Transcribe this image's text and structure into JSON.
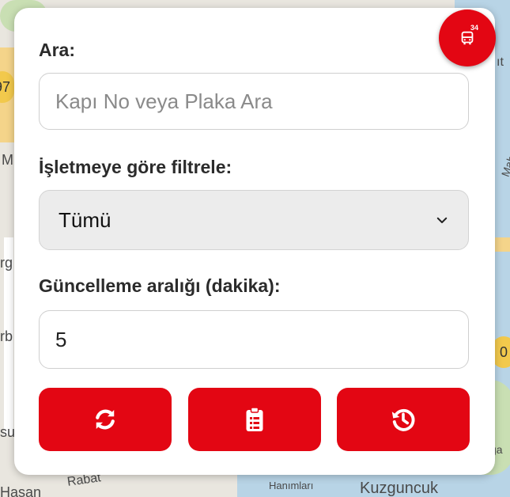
{
  "map": {
    "labels": [
      "Kuzguncuk",
      "Rabat",
      "Hanımları",
      "Hasan",
      "ğa",
      "Mah.",
      "rg",
      "rb",
      "su",
      "M",
      "ıt"
    ],
    "badges": [
      "97",
      "0"
    ]
  },
  "fab": {
    "icon": "bus-icon",
    "number": "34"
  },
  "search": {
    "label": "Ara:",
    "placeholder": "Kapı No veya Plaka Ara",
    "value": ""
  },
  "operator_filter": {
    "label": "İşletmeye göre filtrele:",
    "selected": "Tümü"
  },
  "update_interval": {
    "label": "Güncelleme aralığı (dakika):",
    "value": "5"
  },
  "buttons": [
    {
      "icon": "refresh-icon"
    },
    {
      "icon": "clipboard-list-icon"
    },
    {
      "icon": "history-icon"
    }
  ],
  "colors": {
    "accent": "#e30613",
    "select_bg": "#ececec",
    "panel_bg": "#ffffff"
  }
}
